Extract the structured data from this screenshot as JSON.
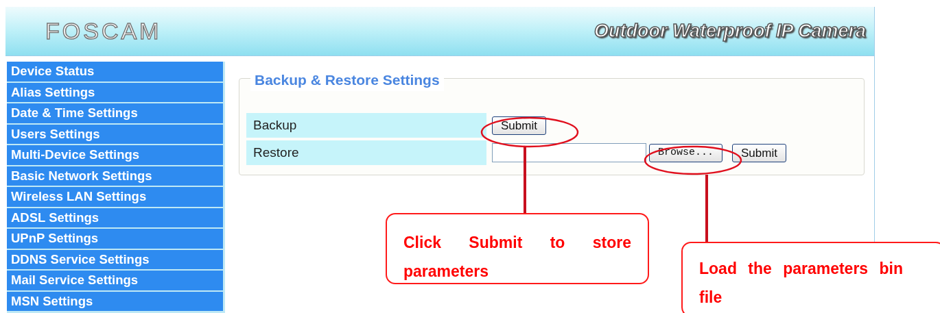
{
  "header": {
    "logo": "FOSCAM",
    "tagline": "Outdoor Waterproof IP Camera"
  },
  "sidebar": {
    "items": [
      "Device Status",
      "Alias Settings",
      "Date & Time Settings",
      "Users Settings",
      "Multi-Device Settings",
      "Basic Network Settings",
      "Wireless LAN Settings",
      "ADSL Settings",
      "UPnP Settings",
      "DDNS Service Settings",
      "Mail Service Settings",
      "MSN Settings"
    ]
  },
  "panel": {
    "title": "Backup & Restore Settings",
    "rows": [
      {
        "kind": "button",
        "label": "Backup",
        "button": "Submit"
      },
      {
        "kind": "file",
        "label": "Restore",
        "browse": "Browse...",
        "button": "Submit"
      }
    ]
  },
  "annotations": [
    {
      "text": "Click Submit to store parameters"
    },
    {
      "text": "Load the parameters bin file"
    }
  ]
}
